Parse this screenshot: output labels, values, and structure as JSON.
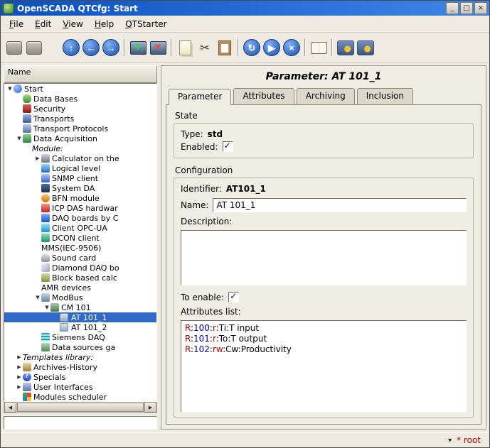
{
  "theme": {
    "titlebar_from": "#0b50c0",
    "titlebar_to": "#3f86e8",
    "selection_color": "#3169c6",
    "user_color": "#b00000",
    "attribute_part_colors": [
      "#b00000",
      "#0000b0",
      "#b00000",
      "#000000",
      "#000000"
    ]
  },
  "window": {
    "title": "OpenSCADA QTCfg: Start",
    "controls": {
      "minimize": "_",
      "maximize": "□",
      "close": "×"
    }
  },
  "menubar": {
    "items": [
      "File",
      "Edit",
      "View",
      "Help",
      "QTStarter"
    ]
  },
  "toolbar": {
    "items": [
      {
        "kind": "device",
        "name": "load-from-db-button",
        "icon": "load-db-icon"
      },
      {
        "kind": "device",
        "name": "save-to-db-button",
        "icon": "save-db-icon"
      },
      {
        "kind": "gap"
      },
      {
        "kind": "circle",
        "glyph": "↑",
        "name": "up-button",
        "icon": "up-arrow-icon"
      },
      {
        "kind": "circle",
        "glyph": "←",
        "name": "back-button",
        "icon": "back-arrow-icon"
      },
      {
        "kind": "circle",
        "glyph": "→",
        "name": "forward-button",
        "icon": "forward-arrow-icon"
      },
      {
        "kind": "sep"
      },
      {
        "kind": "monitor",
        "glyph": "+",
        "color": "#39d439",
        "name": "add-item-button",
        "icon": "add-item-icon"
      },
      {
        "kind": "monitor",
        "glyph": "×",
        "color": "#ff4030",
        "name": "delete-item-button",
        "icon": "delete-item-icon"
      },
      {
        "kind": "sep"
      },
      {
        "kind": "copy",
        "name": "copy-item-button",
        "icon": "copy-icon"
      },
      {
        "kind": "cut",
        "glyph": "✂",
        "name": "cut-item-button",
        "icon": "scissors-icon"
      },
      {
        "kind": "paste",
        "name": "paste-item-button",
        "icon": "clipboard-icon"
      },
      {
        "kind": "sep"
      },
      {
        "kind": "circle",
        "glyph": "↻",
        "name": "refresh-button",
        "icon": "refresh-icon"
      },
      {
        "kind": "circle",
        "glyph": "▶",
        "name": "start-button",
        "icon": "play-icon"
      },
      {
        "kind": "circle",
        "glyph": "×",
        "name": "stop-button",
        "icon": "stop-icon"
      },
      {
        "kind": "sep"
      },
      {
        "kind": "book",
        "name": "manual-button",
        "icon": "book-icon"
      },
      {
        "kind": "sep"
      },
      {
        "kind": "gear",
        "name": "qtstarter-config-button",
        "icon": "gear-icon"
      },
      {
        "kind": "gear",
        "name": "qtstarter-config2-button",
        "icon": "gear-icon"
      }
    ]
  },
  "tree": {
    "header": "Name",
    "items": [
      {
        "label": "Start",
        "depth": 0,
        "icon": "start",
        "expander": "open"
      },
      {
        "label": "Data Bases",
        "depth": 1,
        "icon": "database"
      },
      {
        "label": "Security",
        "depth": 1,
        "icon": "security"
      },
      {
        "label": "Transports",
        "depth": 1,
        "icon": "transports"
      },
      {
        "label": "Transport Protocols",
        "depth": 1,
        "icon": "protocols"
      },
      {
        "label": "Data Acquisition",
        "depth": 1,
        "icon": "daq",
        "expander": "open"
      },
      {
        "label": "Module:",
        "depth": 2,
        "italic": true
      },
      {
        "label": "Calculator on the",
        "depth": 3,
        "icon": "calculator",
        "expander": "closed"
      },
      {
        "label": "Logical level",
        "depth": 3,
        "icon": "logical"
      },
      {
        "label": "SNMP client",
        "depth": 3,
        "icon": "snmp"
      },
      {
        "label": "System DA",
        "depth": 3,
        "icon": "systemda"
      },
      {
        "label": "BFN module",
        "depth": 3,
        "icon": "bfn"
      },
      {
        "label": "ICP DAS hardwar",
        "depth": 3,
        "icon": "icpdas"
      },
      {
        "label": "DAQ boards by C",
        "depth": 3,
        "icon": "daqboards"
      },
      {
        "label": "Client OPC-UA",
        "depth": 3,
        "icon": "opcua"
      },
      {
        "label": "DCON client",
        "depth": 3,
        "icon": "dcon"
      },
      {
        "label": "MMS(IEC-9506)",
        "depth": 3
      },
      {
        "label": "Sound card",
        "depth": 3,
        "icon": "soundcard"
      },
      {
        "label": "Diamond DAQ bo",
        "depth": 3,
        "icon": "diamond"
      },
      {
        "label": "Block based calc",
        "depth": 3,
        "icon": "blockcalc"
      },
      {
        "label": "AMR devices",
        "depth": 3
      },
      {
        "label": "ModBus",
        "depth": 3,
        "icon": "modbus",
        "expander": "open"
      },
      {
        "label": "CM 101",
        "depth": 4,
        "icon": "controller",
        "expander": "open"
      },
      {
        "label": "AT 101_1",
        "depth": 5,
        "icon": "parameter",
        "selected": true
      },
      {
        "label": "AT 101_2",
        "depth": 5,
        "icon": "parameter"
      },
      {
        "label": "Siemens DAQ",
        "depth": 3,
        "icon": "siemens"
      },
      {
        "label": "Data sources ga",
        "depth": 3,
        "icon": "datasources"
      },
      {
        "label": "Templates library:",
        "depth": 1,
        "italic": true,
        "expander": "closed"
      },
      {
        "label": "Archives-History",
        "depth": 1,
        "icon": "archives",
        "expander": "closed"
      },
      {
        "label": "Specials",
        "depth": 1,
        "icon": "specials",
        "expander": "closed"
      },
      {
        "label": "User Interfaces",
        "depth": 1,
        "icon": "ui",
        "expander": "closed"
      },
      {
        "label": "Modules scheduler",
        "depth": 1,
        "icon": "scheduler"
      }
    ],
    "filter_value": ""
  },
  "main": {
    "title": "Parameter: AT 101_1",
    "tabs": [
      {
        "label": "Parameter",
        "active": true
      },
      {
        "label": "Attributes",
        "active": false
      },
      {
        "label": "Archiving",
        "active": false
      },
      {
        "label": "Inclusion",
        "active": false
      }
    ],
    "state_group": {
      "label": "State",
      "type_label": "Type:",
      "type_value": "std",
      "enabled_label": "Enabled:",
      "enabled_checked": true
    },
    "config_group": {
      "label": "Configuration",
      "identifier_label": "Identifier:",
      "identifier_value": "AT101_1",
      "name_label": "Name:",
      "name_value": "AT 101_1",
      "description_label": "Description:",
      "description_value": "",
      "to_enable_label": "To enable:",
      "to_enable_checked": true,
      "attributes_label": "Attributes list:",
      "attributes": [
        {
          "parts": [
            "R",
            "100",
            "r",
            "Ti",
            "T input"
          ]
        },
        {
          "parts": [
            "R",
            "101",
            "r",
            "To",
            "T output"
          ]
        },
        {
          "parts": [
            "R",
            "102",
            "rw",
            "Cw",
            "Productivity"
          ]
        }
      ]
    }
  },
  "statusbar": {
    "user": "* root"
  }
}
